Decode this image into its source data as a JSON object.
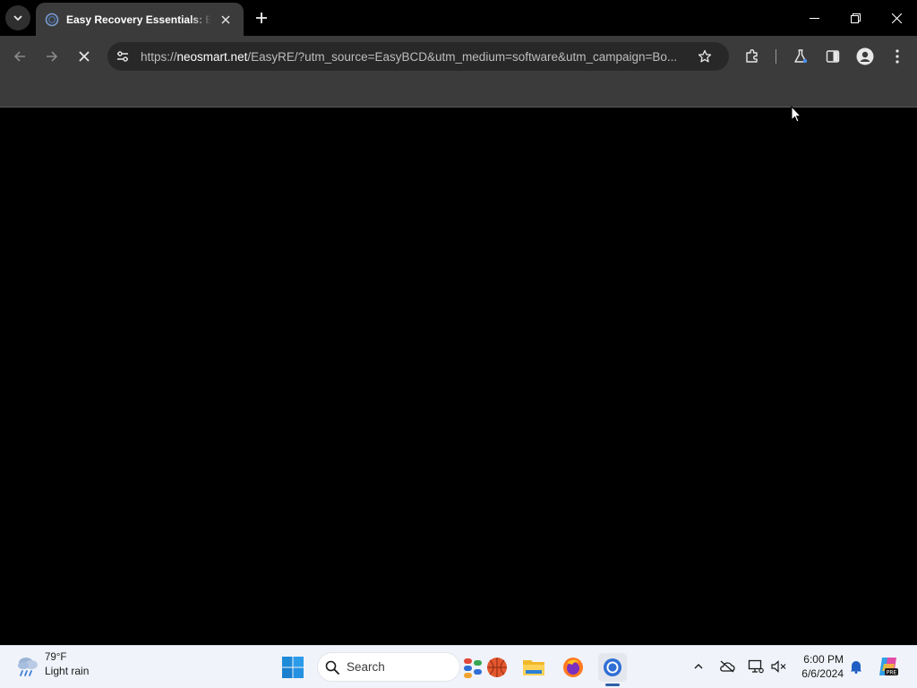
{
  "browser": {
    "tab": {
      "title": "Easy Recovery Essentials: Boot",
      "favicon": "neosmart-favicon"
    },
    "address_bar": {
      "url_scheme": "https://",
      "url_host": "neosmart.net",
      "url_rest": "/EasyRE/?utm_source=EasyBCD&utm_medium=software&utm_campaign=Bo..."
    },
    "loading": true
  },
  "taskbar": {
    "weather": {
      "temperature": "79°F",
      "condition": "Light rain"
    },
    "search": {
      "placeholder": "Search"
    },
    "clock": {
      "time": "6:00 PM",
      "date": "6/6/2024"
    }
  },
  "colors": {
    "titlebar_bg": "#000000",
    "toolbar_bg": "#3b3b3b",
    "omnibox_bg": "#282828",
    "content_bg": "#000000",
    "taskbar_bg": "#f0f3f9",
    "accent": "#2f5fa8"
  }
}
